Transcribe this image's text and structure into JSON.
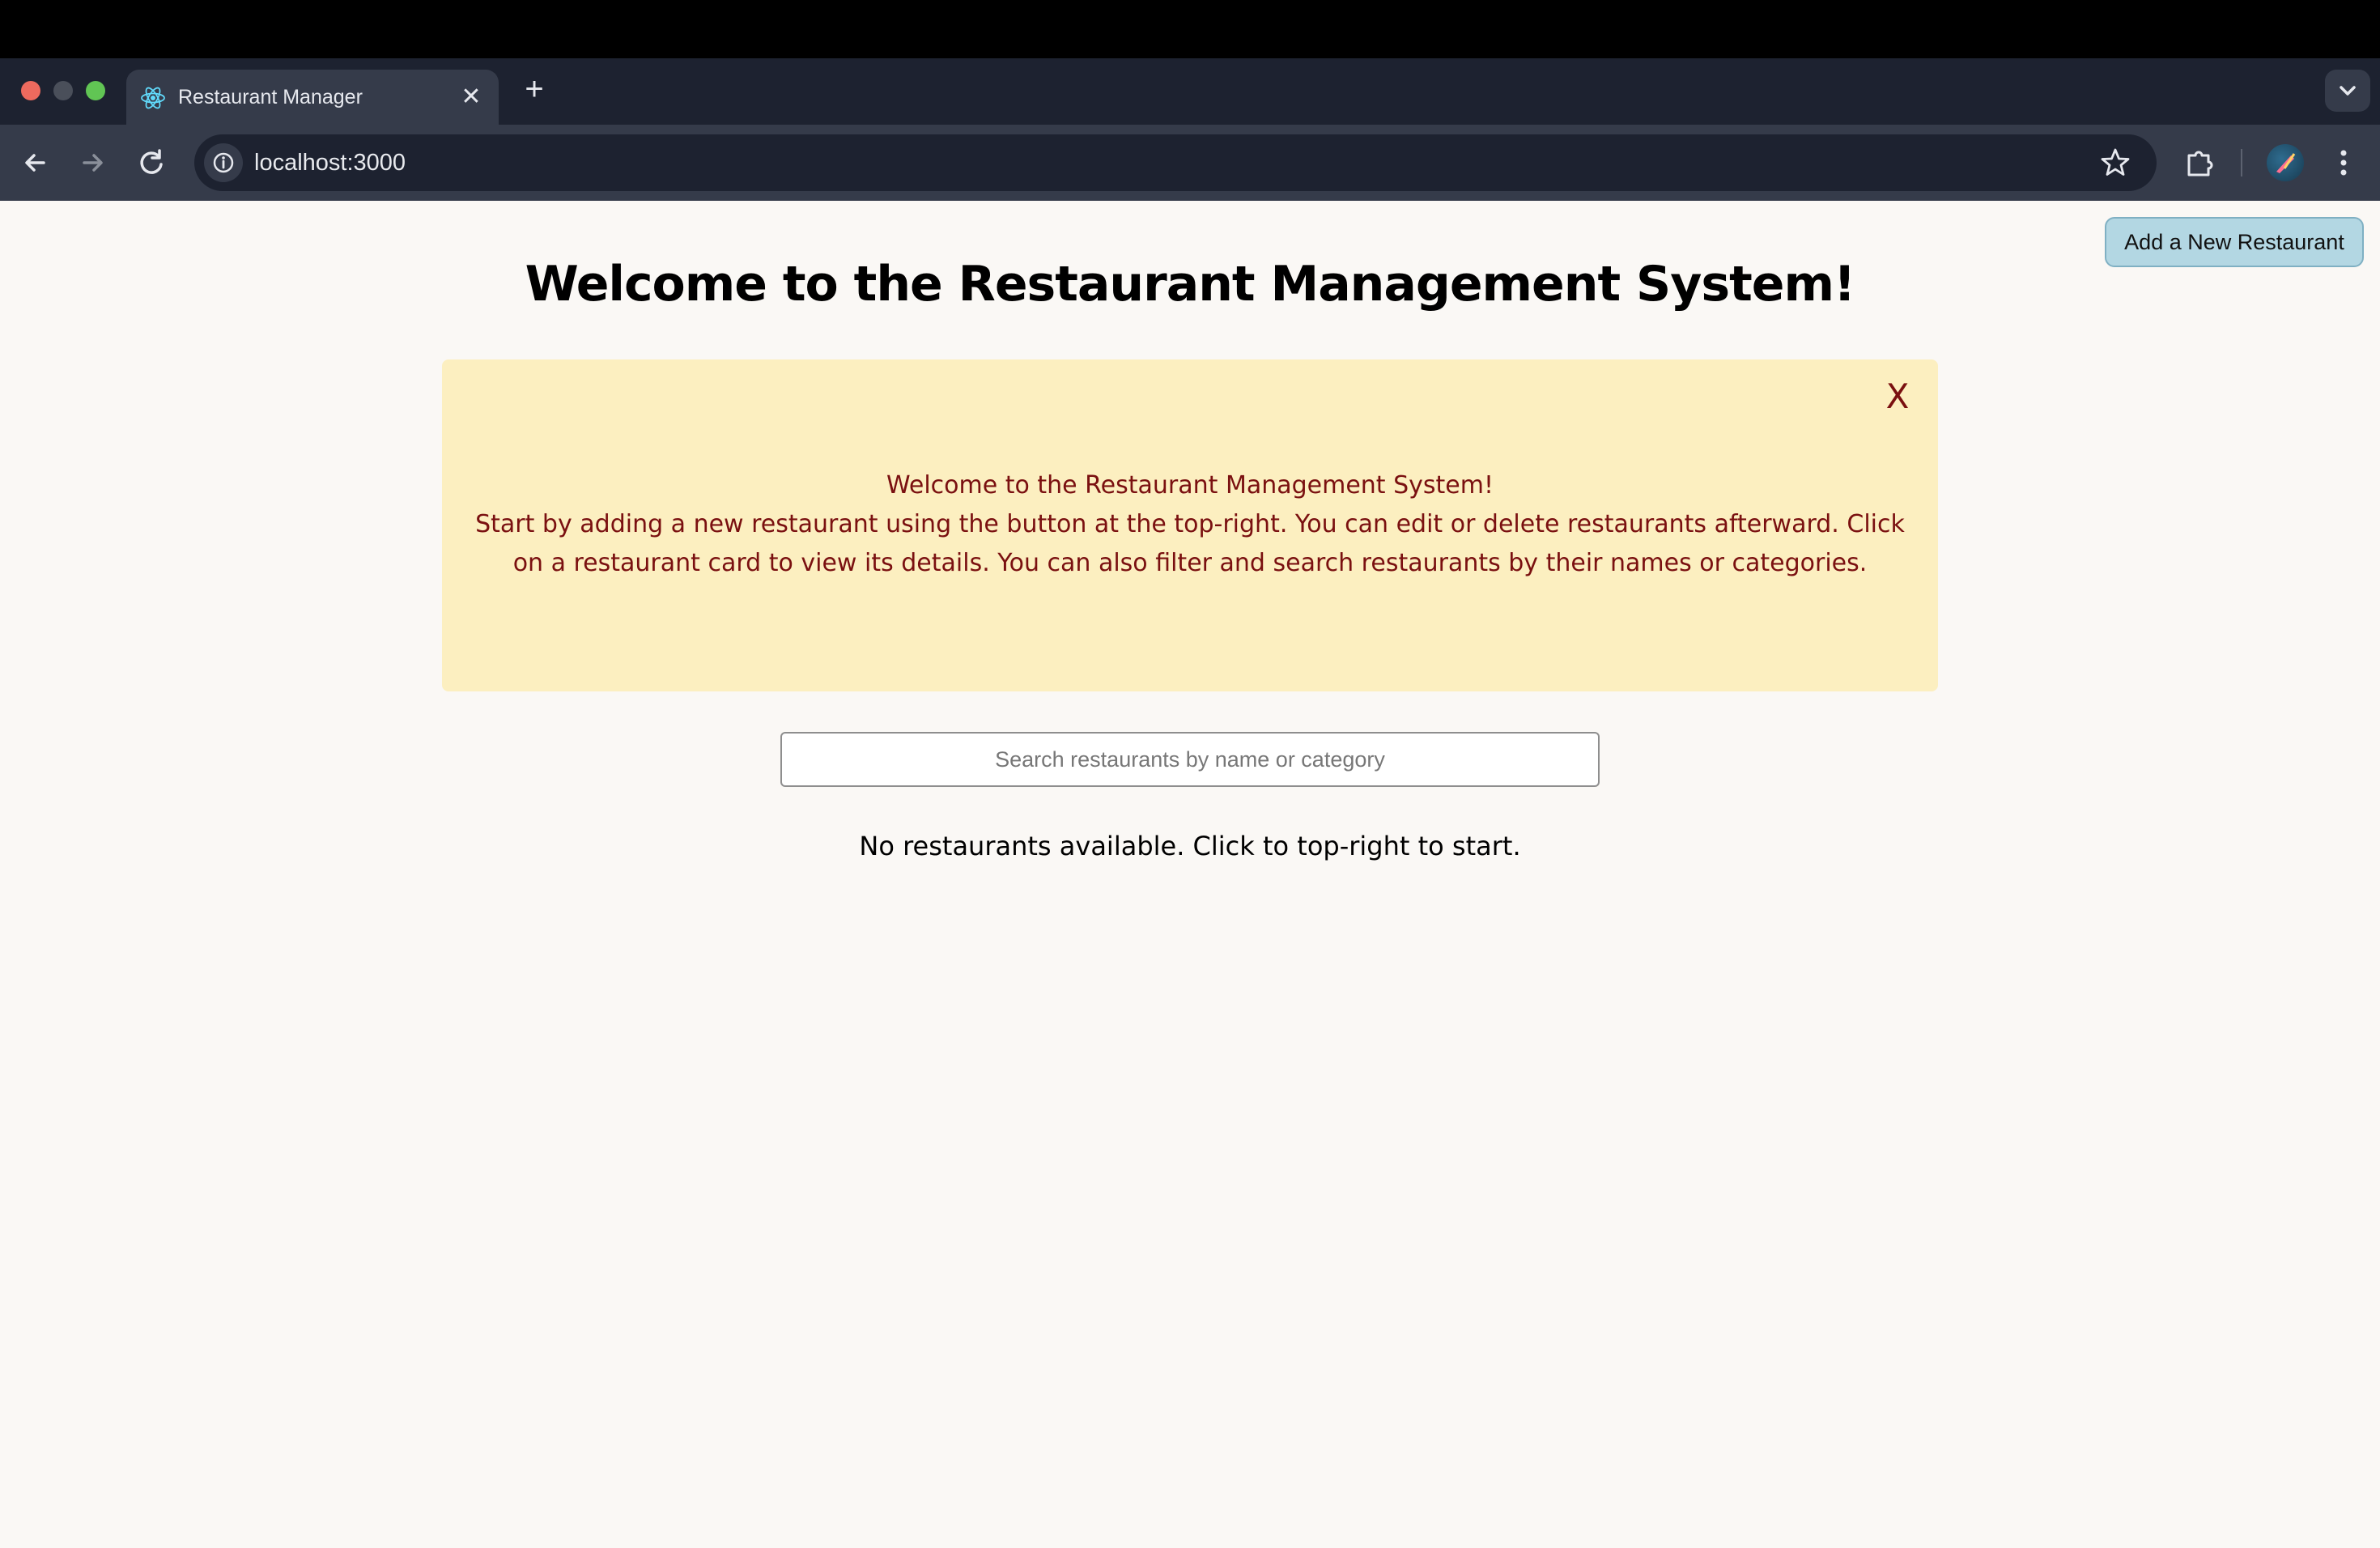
{
  "browser": {
    "tab": {
      "title": "Restaurant Manager",
      "close": "✕"
    },
    "new_tab": "+",
    "url": "localhost:3000"
  },
  "page": {
    "add_button_label": "Add a New Restaurant",
    "title": "Welcome to the Restaurant Management System!",
    "banner": {
      "close_label": "X",
      "line1": "Welcome to the Restaurant Management System!",
      "line2": "Start by adding a new restaurant using the button at the top-right. You can edit or delete restaurants afterward. Click on a restaurant card to view its details. You can also filter and search restaurants by their names or categories."
    },
    "search": {
      "placeholder": "Search restaurants by name or category",
      "value": ""
    },
    "empty_message": "No restaurants available. Click to top-right to start."
  },
  "colors": {
    "page_background": "#faf8f5",
    "banner_background": "#fcefc0",
    "banner_text": "#7a1010",
    "add_button_background": "#b3d7e3"
  },
  "icons": {
    "tab_favicon": "react-atom-icon",
    "back": "arrow-left-icon",
    "forward": "arrow-right-icon",
    "reload": "reload-icon",
    "site_info": "info-icon",
    "bookmark": "star-icon",
    "extensions": "puzzle-icon",
    "menu": "kebab-menu-icon",
    "tab_list": "chevron-down-icon"
  }
}
